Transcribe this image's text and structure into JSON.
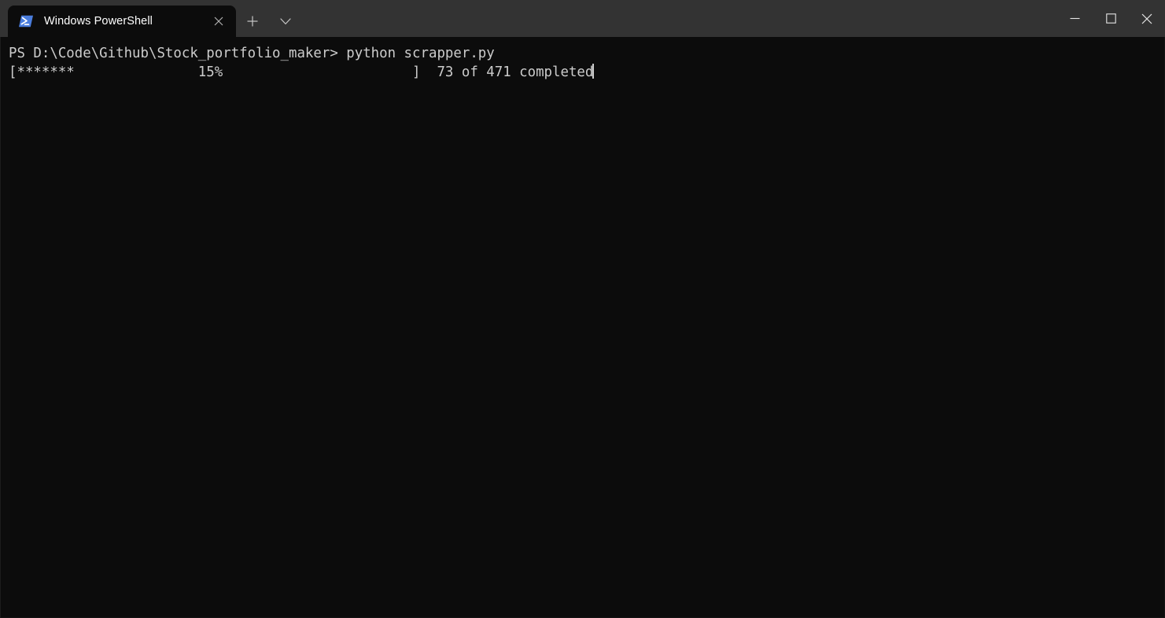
{
  "window": {
    "app_title": "Windows PowerShell",
    "titlebar_bg": "#333333",
    "terminal_bg": "#0c0c0c",
    "text_color": "#cccccc",
    "accent_color": "#4a7ddd"
  },
  "tabs": [
    {
      "label": "Windows PowerShell",
      "icon": "powershell-icon",
      "close_label": "×",
      "active": true
    }
  ],
  "tabbar": {
    "new_tab_label": "+",
    "dropdown_label": "⌄"
  },
  "window_controls": {
    "minimize_label": "—",
    "maximize_label": "□",
    "close_label": "✕"
  },
  "terminal": {
    "lines": [
      "PS D:\\Code\\Github\\Stock_portfolio_maker> python scrapper.py",
      "[*******               15%                       ]  73 of 471 completed"
    ],
    "prompt": "PS D:\\Code\\Github\\Stock_portfolio_maker>",
    "command": "python scrapper.py",
    "progress": {
      "bar_open": "[",
      "filled_chars": "*******",
      "percent_label": "15%",
      "percent_value": 15,
      "bar_close": "]",
      "status": "73 of 471 completed",
      "completed": 73,
      "total": 471
    },
    "cursor_visible": true
  }
}
